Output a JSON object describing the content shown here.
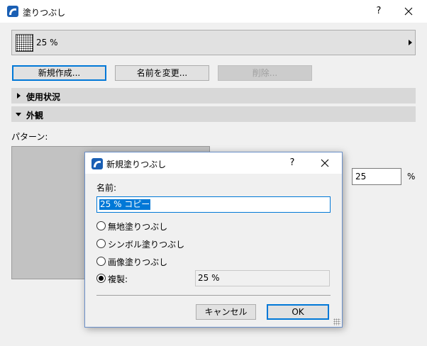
{
  "window": {
    "title": "塗りつぶし",
    "help_label": "?",
    "brand_color": "#1a5fb4"
  },
  "fill_selector": {
    "value": "25 %"
  },
  "buttons": {
    "new": "新規作成...",
    "rename": "名前を変更...",
    "delete": "削除..."
  },
  "sections": {
    "usage": "使用状況",
    "appearance": "外観"
  },
  "appearance": {
    "pattern_label": "パターン:",
    "percent_value": "25",
    "percent_unit": "%"
  },
  "dialog": {
    "title": "新規塗りつぶし",
    "help_label": "?",
    "name_label": "名前:",
    "name_value": "25 % コピー",
    "options": [
      {
        "label": "無地塗りつぶし",
        "checked": false
      },
      {
        "label": "シンボル塗りつぶし",
        "checked": false
      },
      {
        "label": "画像塗りつぶし",
        "checked": false
      },
      {
        "label": "複製:",
        "checked": true
      }
    ],
    "duplicate_source": "25 %",
    "cancel_label": "キャンセル",
    "ok_label": "OK"
  }
}
